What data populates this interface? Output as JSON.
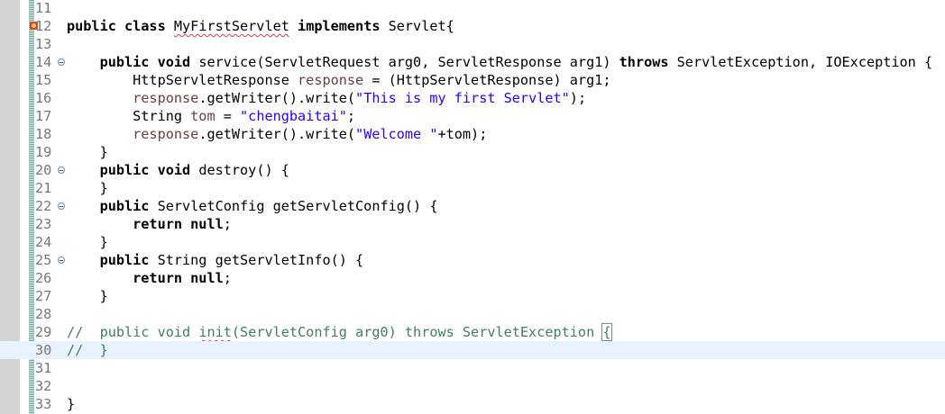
{
  "editor": {
    "lines": [
      {
        "num": "11",
        "segments": []
      },
      {
        "num": "12",
        "marker": "error",
        "segments": [
          {
            "t": "public class ",
            "c": "kw"
          },
          {
            "t": "MyFirstServlet",
            "c": "plain",
            "sq": true
          },
          {
            "t": " ",
            "c": "plain"
          },
          {
            "t": "implements",
            "c": "kw"
          },
          {
            "t": " Servlet{",
            "c": "plain"
          }
        ]
      },
      {
        "num": "13",
        "segments": []
      },
      {
        "num": "14",
        "fold": true,
        "segments": [
          {
            "t": "    public void ",
            "c": "kw"
          },
          {
            "t": "service(ServletRequest arg0, ServletResponse arg1) ",
            "c": "plain"
          },
          {
            "t": "throws",
            "c": "kw"
          },
          {
            "t": " ServletException, IOException {",
            "c": "plain"
          }
        ]
      },
      {
        "num": "15",
        "segments": [
          {
            "t": "        HttpServletResponse ",
            "c": "plain"
          },
          {
            "t": "response",
            "c": "var"
          },
          {
            "t": " = (HttpServletResponse) arg1;",
            "c": "plain"
          }
        ]
      },
      {
        "num": "16",
        "segments": [
          {
            "t": "        response",
            "c": "var"
          },
          {
            "t": ".getWriter().write(",
            "c": "plain"
          },
          {
            "t": "\"This is my first Servlet\"",
            "c": "str"
          },
          {
            "t": ");",
            "c": "plain"
          }
        ]
      },
      {
        "num": "17",
        "segments": [
          {
            "t": "        String ",
            "c": "plain"
          },
          {
            "t": "tom",
            "c": "var"
          },
          {
            "t": " = ",
            "c": "plain"
          },
          {
            "t": "\"chengbaitai\"",
            "c": "str"
          },
          {
            "t": ";",
            "c": "plain"
          }
        ]
      },
      {
        "num": "18",
        "segments": [
          {
            "t": "        response",
            "c": "var"
          },
          {
            "t": ".getWriter().write(",
            "c": "plain"
          },
          {
            "t": "\"Welcome \"",
            "c": "str"
          },
          {
            "t": "+tom);",
            "c": "plain"
          }
        ]
      },
      {
        "num": "19",
        "segments": [
          {
            "t": "    }",
            "c": "plain"
          }
        ]
      },
      {
        "num": "20",
        "fold": true,
        "segments": [
          {
            "t": "    public void ",
            "c": "kw"
          },
          {
            "t": "destroy() {",
            "c": "plain"
          }
        ]
      },
      {
        "num": "21",
        "segments": [
          {
            "t": "    }",
            "c": "plain"
          }
        ]
      },
      {
        "num": "22",
        "fold": true,
        "segments": [
          {
            "t": "    public ",
            "c": "kw"
          },
          {
            "t": "ServletConfig getServletConfig() {",
            "c": "plain"
          }
        ]
      },
      {
        "num": "23",
        "segments": [
          {
            "t": "        return null",
            "c": "kw"
          },
          {
            "t": ";",
            "c": "plain"
          }
        ]
      },
      {
        "num": "24",
        "segments": [
          {
            "t": "    }",
            "c": "plain"
          }
        ]
      },
      {
        "num": "25",
        "fold": true,
        "segments": [
          {
            "t": "    public ",
            "c": "kw"
          },
          {
            "t": "String getServletInfo() {",
            "c": "plain"
          }
        ]
      },
      {
        "num": "26",
        "segments": [
          {
            "t": "        return null",
            "c": "kw"
          },
          {
            "t": ";",
            "c": "plain"
          }
        ]
      },
      {
        "num": "27",
        "segments": [
          {
            "t": "    }",
            "c": "plain"
          }
        ]
      },
      {
        "num": "28",
        "segments": []
      },
      {
        "num": "29",
        "segments": [
          {
            "t": "//  public void ",
            "c": "cmt"
          },
          {
            "t": "init",
            "c": "cmt",
            "sq": true
          },
          {
            "t": "(ServletConfig arg0) throws ServletException ",
            "c": "cmt"
          },
          {
            "t": "{",
            "c": "cmt",
            "box": true
          }
        ]
      },
      {
        "num": "30",
        "current": true,
        "segments": [
          {
            "t": "//  }",
            "c": "cmt"
          }
        ]
      },
      {
        "num": "31",
        "segments": []
      },
      {
        "num": "32",
        "segments": []
      },
      {
        "num": "33",
        "segments": [
          {
            "t": "}",
            "c": "plain"
          }
        ]
      }
    ]
  }
}
